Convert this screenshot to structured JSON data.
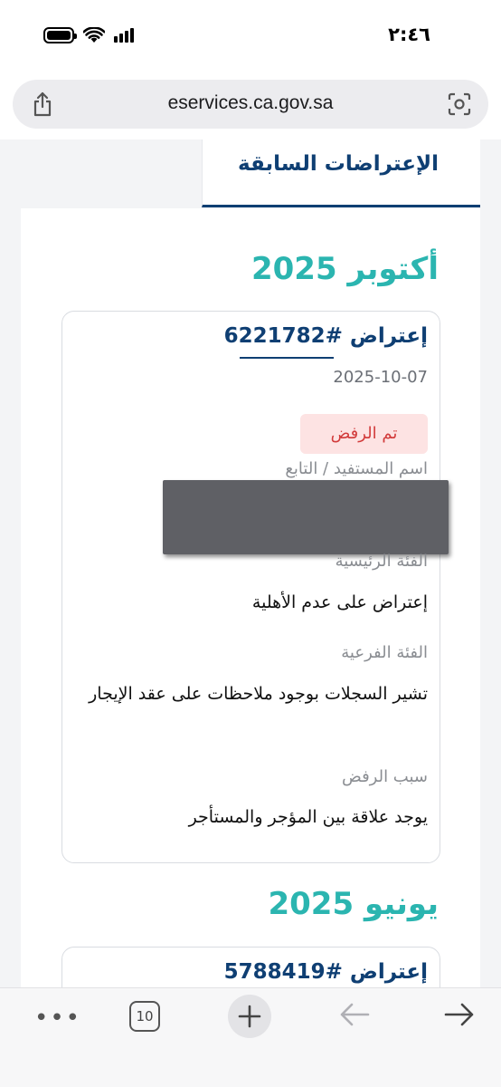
{
  "status_bar": {
    "time": "٢:٤٦"
  },
  "browser": {
    "url": "eservices.ca.gov.sa",
    "tab_count": "10"
  },
  "page": {
    "tab_label": "الإعتراضات السابقة",
    "groups": [
      {
        "month": "أكتوبر 2025",
        "objection": {
          "title": "إعتراض #6221782",
          "date": "2025-10-07",
          "status": "تم الرفض",
          "beneficiary_label": "اسم المستفيد / التابع",
          "main_category_label": "الفئة الرئيسية",
          "main_category_value": "إعتراض على عدم الأهلية",
          "sub_category_label": "الفئة الفرعية",
          "sub_category_value": "تشير السجلات بوجود ملاحظات على عقد الإيجار",
          "rejection_reason_label": "سبب الرفض",
          "rejection_reason_value": "يوجد علاقة بين المؤجر والمستأجر"
        }
      },
      {
        "month": "يونيو 2025",
        "objection": {
          "title": "إعتراض #5788419"
        }
      }
    ]
  },
  "colors": {
    "primary": "#0f3f73",
    "accent": "#2bb5b0",
    "rejected_bg": "#fde3e3",
    "rejected_text": "#d23b3b"
  }
}
